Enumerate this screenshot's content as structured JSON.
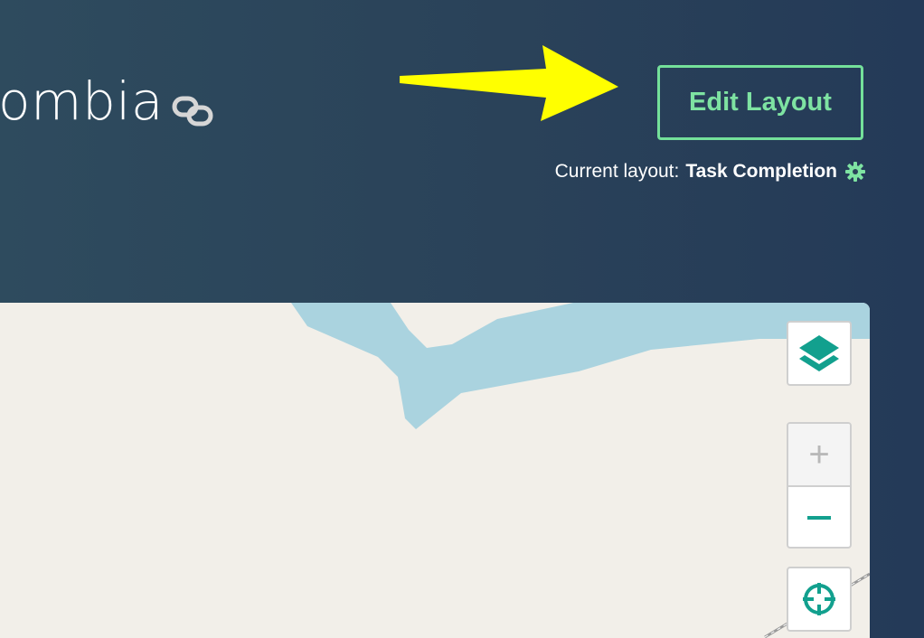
{
  "header": {
    "title": "ombia",
    "edit_layout_label": "Edit Layout",
    "current_layout_label": "Current layout:",
    "current_layout_value": "Task Completion"
  },
  "map": {
    "zoom_in_label": "+",
    "icons": [
      "layers-icon",
      "minus-icon",
      "crosshair-icon"
    ]
  },
  "colors": {
    "header_bg": "#2a4259",
    "accent_green": "#74e09a",
    "map_teal": "#12a08e",
    "map_land": "#f2efe9",
    "map_water": "#aad3df",
    "annotation_arrow": "#ffff00"
  }
}
